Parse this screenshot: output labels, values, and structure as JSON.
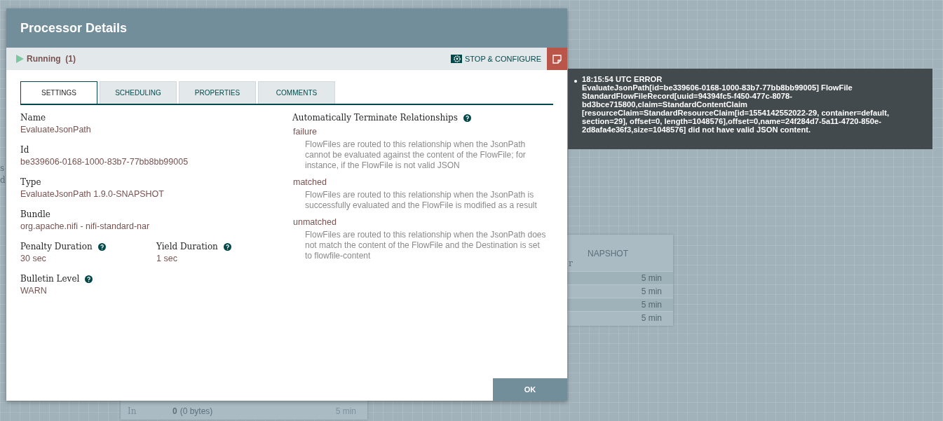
{
  "dialog": {
    "title": "Processor Details",
    "status": {
      "label": "Running",
      "count": "(1)",
      "running": true
    },
    "action": {
      "label": "STOP & CONFIGURE"
    },
    "tabs": [
      {
        "label": "SETTINGS",
        "selected": true
      },
      {
        "label": "SCHEDULING",
        "selected": false
      },
      {
        "label": "PROPERTIES",
        "selected": false
      },
      {
        "label": "COMMENTS",
        "selected": false
      }
    ],
    "fields": [
      {
        "label": "Name",
        "value": "EvaluateJsonPath",
        "help": false
      },
      {
        "label": "Id",
        "value": "be339606-0168-1000-83b7-77bb8bb99005",
        "help": false
      },
      {
        "label": "Type",
        "value": "EvaluateJsonPath 1.9.0-SNAPSHOT",
        "help": false
      },
      {
        "label": "Bundle",
        "value": "org.apache.nifi - nifi-standard-nar",
        "help": false
      }
    ],
    "paired_fields": [
      {
        "label": "Penalty Duration",
        "value": "30 sec",
        "help": true
      },
      {
        "label": "Yield Duration",
        "value": "1 sec",
        "help": true
      }
    ],
    "bulletin_level": {
      "label": "Bulletin Level",
      "value": "WARN",
      "help": true
    },
    "relationships": {
      "label": "Automatically Terminate Relationships",
      "help": true,
      "items": [
        {
          "name": "failure",
          "description": "FlowFiles are routed to this relationship when the JsonPath cannot be evaluated against the content of the FlowFile; for instance, if the FlowFile is not valid JSON"
        },
        {
          "name": "matched",
          "description": "FlowFiles are routed to this relationship when the JsonPath is successfully evaluated and the FlowFile is modified as a result"
        },
        {
          "name": "unmatched",
          "description": "FlowFiles are routed to this relationship when the JsonPath does not match the content of the FlowFile and the Destination is set to flowfile-content"
        }
      ]
    },
    "ok_button": "OK"
  },
  "bulletin": {
    "time": "18:15:54 UTC",
    "level": "ERROR",
    "message": "EvaluateJsonPath[id=be339606-0168-1000-83b7-77bb8bb99005] FlowFile StandardFlowFileRecord[uuid=94394fc5-f450-477c-8078-bd3bce715800,claim=StandardContentClaim [resourceClaim=StandardResourceClaim[id=1554142552022-29, container=default, section=29], offset=0, length=1048576],offset=0,name=24f284d7-5a11-4720-850e-2d8afa4e36f3,size=1048576] did not have valid JSON content."
  },
  "canvas": {
    "right_card": {
      "type_text": "NAPSHOT",
      "bundle_text": "r",
      "rows": [
        "5 min",
        "5 min",
        "5 min",
        "5 min"
      ]
    },
    "bottom_card": {
      "row": {
        "label": "In",
        "count": "0",
        "size": "(0 bytes)",
        "time": "5 min"
      }
    },
    "left_fragments": [
      "s",
      "d"
    ]
  }
}
